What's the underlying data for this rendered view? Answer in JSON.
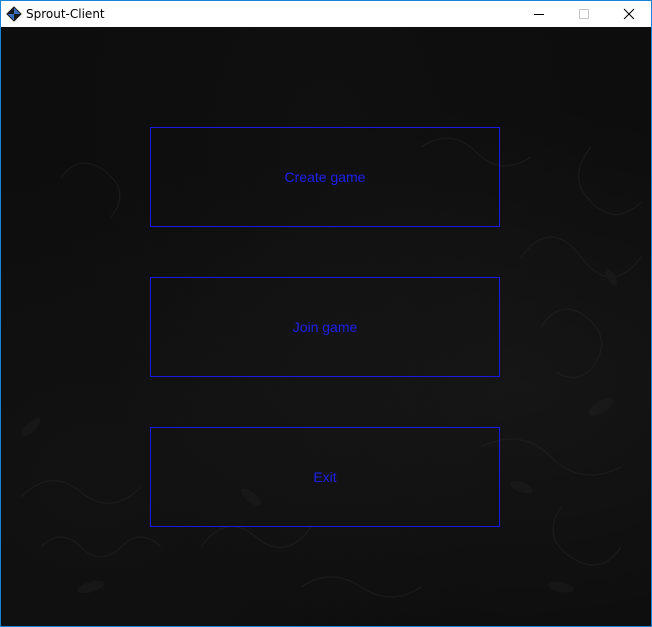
{
  "window": {
    "title": "Sprout-Client",
    "accent_color": "#1883d7",
    "controls": {
      "minimize_icon": "minimize-icon",
      "maximize_icon": "maximize-icon",
      "close_icon": "close-icon"
    }
  },
  "menu": {
    "button_border_color": "#1a1ae6",
    "button_text_color": "#1f1ff0",
    "background_color": "#0d0d0d",
    "items": [
      {
        "label": "Create game"
      },
      {
        "label": "Join game"
      },
      {
        "label": "Exit"
      }
    ]
  }
}
